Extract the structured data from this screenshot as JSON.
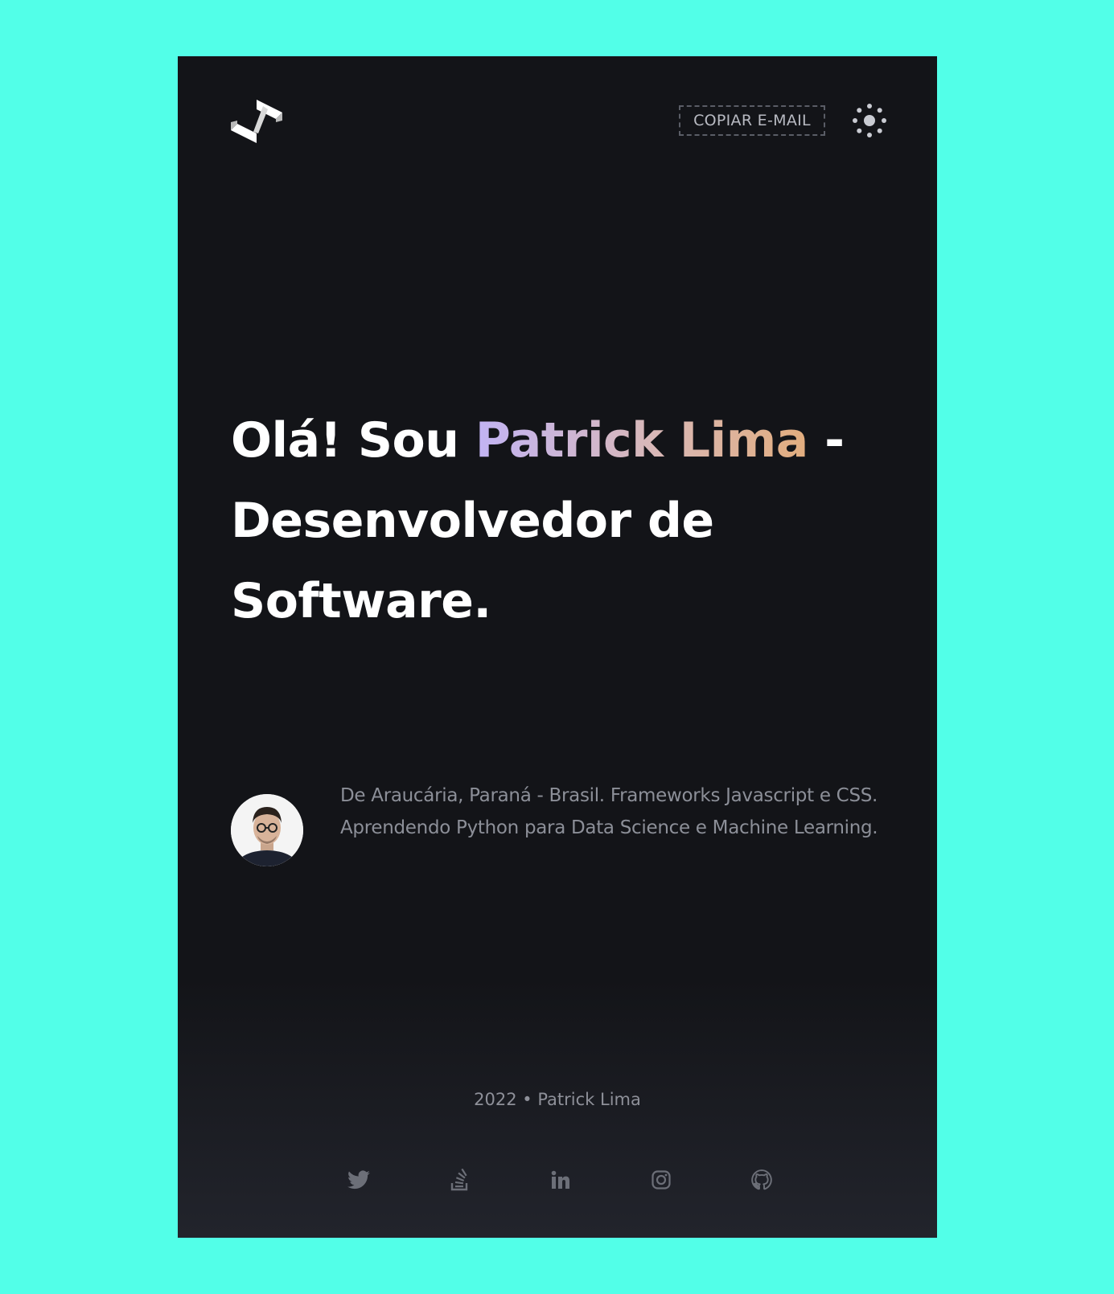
{
  "header": {
    "copy_email_label": "COPIAR E-MAIL",
    "logo_icon": "code-chevrons-logo",
    "theme_icon": "sun-icon"
  },
  "hero": {
    "greeting": "Olá! Sou ",
    "name": "Patrick Lima",
    "suffix": " - Desenvolvedor de Software."
  },
  "about": {
    "bio": "De Araucária, Paraná - Brasil. Frameworks Javascript e CSS. Aprendendo Python para Data Science e Machine Learning."
  },
  "footer": {
    "copyright": "2022 • Patrick Lima",
    "socials": [
      {
        "icon": "twitter-icon"
      },
      {
        "icon": "stackoverflow-icon"
      },
      {
        "icon": "linkedin-icon"
      },
      {
        "icon": "instagram-icon"
      },
      {
        "icon": "github-icon"
      }
    ]
  },
  "colors": {
    "page_background": "#52ffe8",
    "card_background": "#131418",
    "name_gradient_start": "#c2b4f4",
    "name_gradient_end": "#e2ad7e",
    "muted_text": "#8c8f98"
  }
}
